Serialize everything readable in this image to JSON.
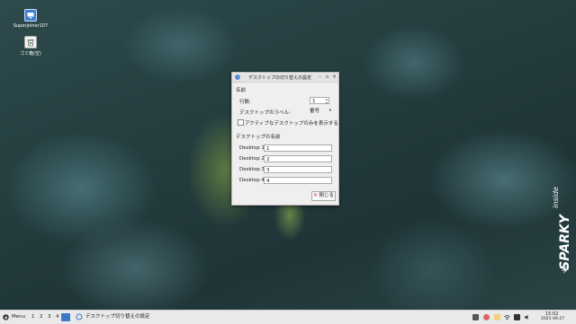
{
  "desktop": {
    "icons": [
      {
        "label": "Superjoiner107",
        "icon": "computer-icon"
      },
      {
        "label": "ゴミ箱(空)",
        "icon": "trash-icon"
      }
    ],
    "brand": {
      "text": "SPARKY",
      "suffix": "inside"
    }
  },
  "dialog": {
    "title": "デスクトップの切り替えの設定",
    "name_section": "名前",
    "rows_label": "行数:",
    "rows_value": "1",
    "desktop_label_label": "デスクトップのラベル:",
    "desktop_label_value": "番号",
    "active_only_label": "アクティブなデスクトップのみを表示する",
    "desktop_names_section": "デスクトップの名前",
    "desktops": [
      {
        "label": "Desktop 1:",
        "value": "1"
      },
      {
        "label": "Desktop 2:",
        "value": "2"
      },
      {
        "label": "Desktop 3:",
        "value": "3"
      },
      {
        "label": "Desktop 4:",
        "value": "4"
      }
    ],
    "close_label": "閉じる"
  },
  "taskbar": {
    "menu_label": "Menu",
    "workspaces": [
      "1",
      "2",
      "3",
      "4"
    ],
    "task_label": "デスクトップ切り替えの設定",
    "clock_time": "15:02",
    "clock_date": "2021-06-27"
  },
  "colors": {
    "accent": "#3a78c8",
    "desktop_bg": "#2a4547",
    "taskbar_bg": "#e9e9e9"
  }
}
